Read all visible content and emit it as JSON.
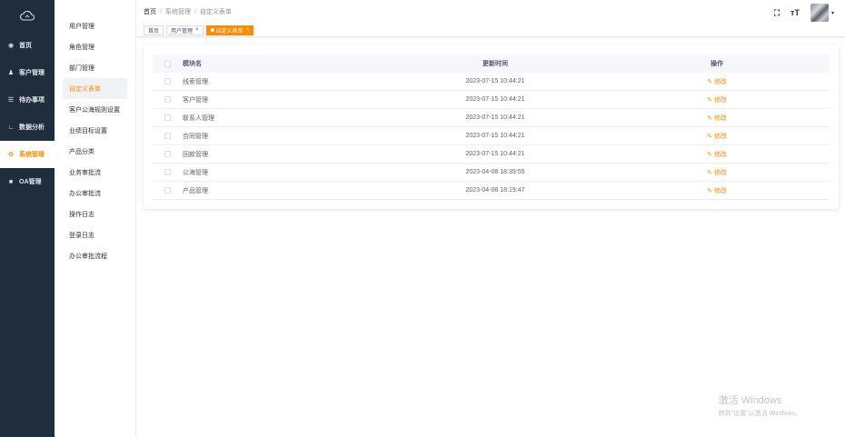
{
  "rail": {
    "items": [
      {
        "label": "首页",
        "icon": "dashboard-icon",
        "glyph": "◉"
      },
      {
        "label": "客户管理",
        "icon": "user-icon",
        "glyph": "♟"
      },
      {
        "label": "待办事项",
        "icon": "list-icon",
        "glyph": "☰"
      },
      {
        "label": "数据分析",
        "icon": "chart-icon",
        "glyph": "∟"
      },
      {
        "label": "系统管理",
        "icon": "gear-icon",
        "glyph": "✿"
      },
      {
        "label": "OA管理",
        "icon": "folder-icon",
        "glyph": "■"
      }
    ],
    "active_index": 4
  },
  "submenu": {
    "items": [
      "用户管理",
      "角色管理",
      "部门管理",
      "自定义表单",
      "客户公海规则设置",
      "业绩目标设置",
      "产品分类",
      "业务审批流",
      "办公审批流",
      "操作日志",
      "登录日志",
      "办公审批流程"
    ],
    "active_index": 3
  },
  "breadcrumb": {
    "home": "首页",
    "sep": "/",
    "level1": "系统管理",
    "level2": "自定义表单"
  },
  "header": {
    "fullscreen_glyph": "⛶",
    "fontsize_glyph": "тT",
    "caret": "▾"
  },
  "tags": [
    {
      "label": "首页",
      "active": false,
      "closable": false
    },
    {
      "label": "用户管理",
      "active": false,
      "closable": true
    },
    {
      "label": "自定义表单",
      "active": true,
      "closable": true
    }
  ],
  "tag_close_glyph": "×",
  "table": {
    "columns": {
      "name": "模块名",
      "time": "更新时间",
      "op": "操作"
    },
    "edit_label": "修改",
    "rows": [
      {
        "name": "线索管理",
        "time": "2023-07-15 10:44:21"
      },
      {
        "name": "客户管理",
        "time": "2023-07-15 10:44:21"
      },
      {
        "name": "联系人管理",
        "time": "2023-07-15 10:44:21"
      },
      {
        "name": "合同管理",
        "time": "2023-07-15 10:44:21"
      },
      {
        "name": "回款管理",
        "time": "2023-07-15 10:44:21"
      },
      {
        "name": "公海管理",
        "time": "2023-04-08 18:39:55"
      },
      {
        "name": "产品管理",
        "time": "2023-04-08 18:19:47"
      }
    ]
  },
  "watermark": {
    "line1": "激活 Windows",
    "line2": "转到\"设置\"以激活 Windows。"
  },
  "colors": {
    "accent": "#ff8a00",
    "rail_bg": "#1f2d3d"
  }
}
